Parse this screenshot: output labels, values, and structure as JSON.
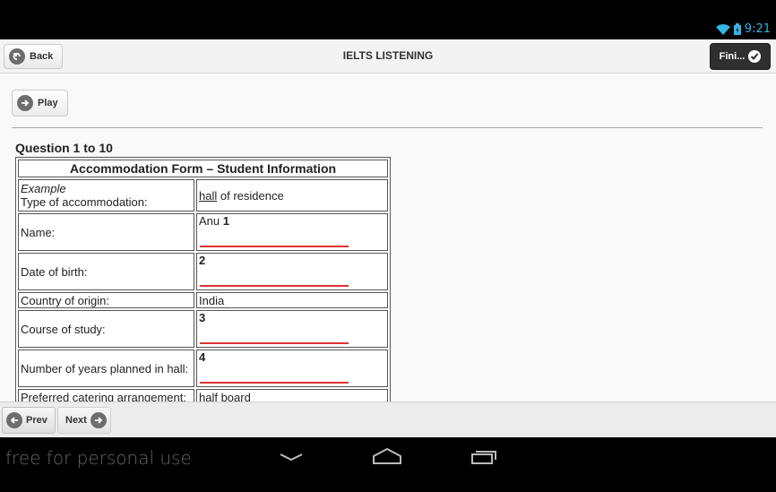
{
  "status": {
    "time": "9:21",
    "wifi_icon": "wifi-icon",
    "battery_icon": "battery-icon",
    "accent": "#33b5e5"
  },
  "header": {
    "title": "IELTS LISTENING",
    "back_label": "Back",
    "finish_label": "Fini..."
  },
  "player": {
    "play_label": "Play"
  },
  "question": {
    "heading": "Question 1 to 10"
  },
  "form": {
    "title": "Accommodation Form – Student Information",
    "example": {
      "tag": "Example",
      "label": "Type of accommodation:",
      "answer_underlined": "hall",
      "answer_rest": " of residence"
    },
    "rows": [
      {
        "label": "Name:",
        "prefix": "Anu ",
        "number": "1"
      },
      {
        "label": "Date of birth:",
        "prefix": "",
        "number": "2"
      },
      {
        "label": "Country of origin:",
        "value": "India"
      },
      {
        "label": "Course of study:",
        "prefix": "",
        "number": "3"
      },
      {
        "label": "Number of years planned in hall:",
        "prefix": "",
        "number": "4"
      },
      {
        "label": "Preferred catering arrangement:",
        "value": "half board"
      }
    ]
  },
  "footer": {
    "prev_label": "Prev",
    "next_label": "Next"
  },
  "system": {
    "watermark": "free for personal use"
  }
}
